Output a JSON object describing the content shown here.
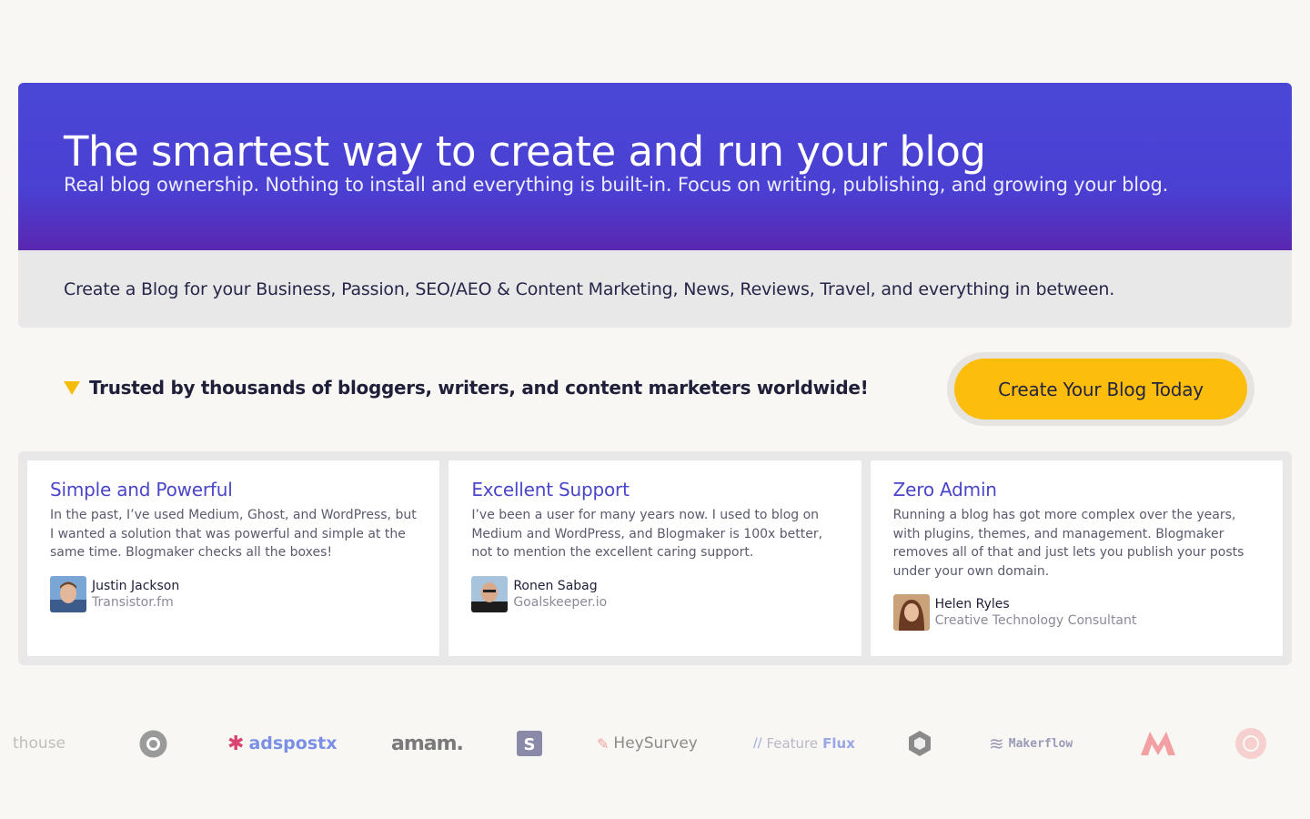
{
  "hero": {
    "title": "The smartest way to create and run your blog",
    "subtitle": "Real blog ownership. Nothing to install and everything is built-in. Focus on writing, publishing, and growing your blog."
  },
  "subbar": {
    "text": "Create a Blog for your Business, Passion, SEO/AEO & Content Marketing, News, Reviews, Travel, and everything in between."
  },
  "trusted": {
    "text": "Trusted by thousands of bloggers, writers, and content marketers worldwide!",
    "icon": "triangle-down-icon"
  },
  "cta": {
    "label": "Create Your Blog Today"
  },
  "testimonials": [
    {
      "title": "Simple and Powerful",
      "quote": "In the past, I’ve used Medium, Ghost, and WordPress, but I wanted a solution that was powerful and simple at the same time. Blogmaker checks all the boxes!",
      "name": "Justin Jackson",
      "company": "Transistor.fm"
    },
    {
      "title": "Excellent Support",
      "quote": "I’ve been a user for many years now. I used to blog on Medium and WordPress, and Blogmaker is 100x better, not to mention the excellent caring support.",
      "name": "Ronen Sabag",
      "company": "Goalskeeper.io"
    },
    {
      "title": "Zero Admin",
      "quote": "Running a blog has got more complex over the years, with plugins, themes, and management. Blogmaker removes all of that and just lets you publish your posts under your own domain.",
      "name": "Helen Ryles",
      "company": "Creative Technology Consultant"
    }
  ],
  "logos": {
    "l1": "thouse",
    "l3": "adspostx",
    "l4": "amam.",
    "l6": "HeySurvey",
    "l7a": "Feature",
    "l7b": "Flux",
    "l9": "Makerflow"
  },
  "colors": {
    "hero_bg": "#4a47d6",
    "accent": "#4a45c9",
    "cta": "#fdbd0d",
    "page_bg": "#f8f7f3"
  }
}
